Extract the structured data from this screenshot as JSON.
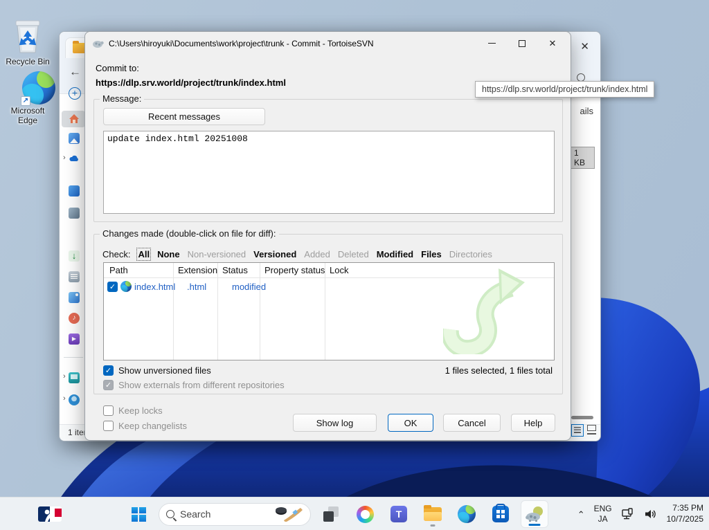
{
  "desktop": {
    "icons": [
      {
        "label": "Recycle Bin"
      },
      {
        "label": "Microsoft Edge"
      }
    ]
  },
  "explorer": {
    "status_items": "1 item",
    "details_label_visible": "ails",
    "size_badge": "1 KB"
  },
  "tooltip": {
    "text": "https://dlp.srv.world/project/trunk/index.html"
  },
  "dialog": {
    "title": "C:\\Users\\hiroyuki\\Documents\\work\\project\\trunk - Commit - TortoiseSVN",
    "commit_to_label": "Commit to:",
    "commit_url": "https://dlp.srv.world/project/trunk/index.html",
    "message_group_label": "Message:",
    "recent_messages_button": "Recent messages",
    "message_text": "update index.html 20251008",
    "changes_group_label": "Changes made (double-click on file for diff):",
    "check_label": "Check:",
    "filters": [
      {
        "label": "All",
        "state": "bold-focus"
      },
      {
        "label": "None",
        "state": "bold"
      },
      {
        "label": "Non-versioned",
        "state": "dim"
      },
      {
        "label": "Versioned",
        "state": "bold"
      },
      {
        "label": "Added",
        "state": "dim"
      },
      {
        "label": "Deleted",
        "state": "dim"
      },
      {
        "label": "Modified",
        "state": "bold"
      },
      {
        "label": "Files",
        "state": "bold"
      },
      {
        "label": "Directories",
        "state": "dim"
      }
    ],
    "table": {
      "headers": [
        "Path",
        "Extension",
        "Status",
        "Property status",
        "Lock"
      ],
      "rows": [
        {
          "path": "index.html",
          "extension": ".html",
          "status": "modified",
          "property_status": "",
          "lock": "",
          "checkbox_state": "checked"
        }
      ]
    },
    "checkboxes": {
      "show_unversioned": {
        "label": "Show unversioned files",
        "state": "checked"
      },
      "show_externals": {
        "label": "Show externals from different repositories",
        "state": "checked-disabled"
      },
      "keep_locks": {
        "label": "Keep locks",
        "state": "unchecked"
      },
      "keep_changelists": {
        "label": "Keep changelists",
        "state": "unchecked"
      }
    },
    "selection_summary": "1 files selected, 1 files total",
    "buttons": {
      "show_log": "Show log",
      "ok": "OK",
      "cancel": "Cancel",
      "help": "Help"
    },
    "accent_color": "#0067c0",
    "link_text_color": "#2160c4"
  },
  "taskbar": {
    "search_placeholder": "Search",
    "tray": {
      "language_top": "ENG",
      "language_bottom": "JA",
      "time": "7:35 PM",
      "date": "10/7/2025"
    }
  }
}
